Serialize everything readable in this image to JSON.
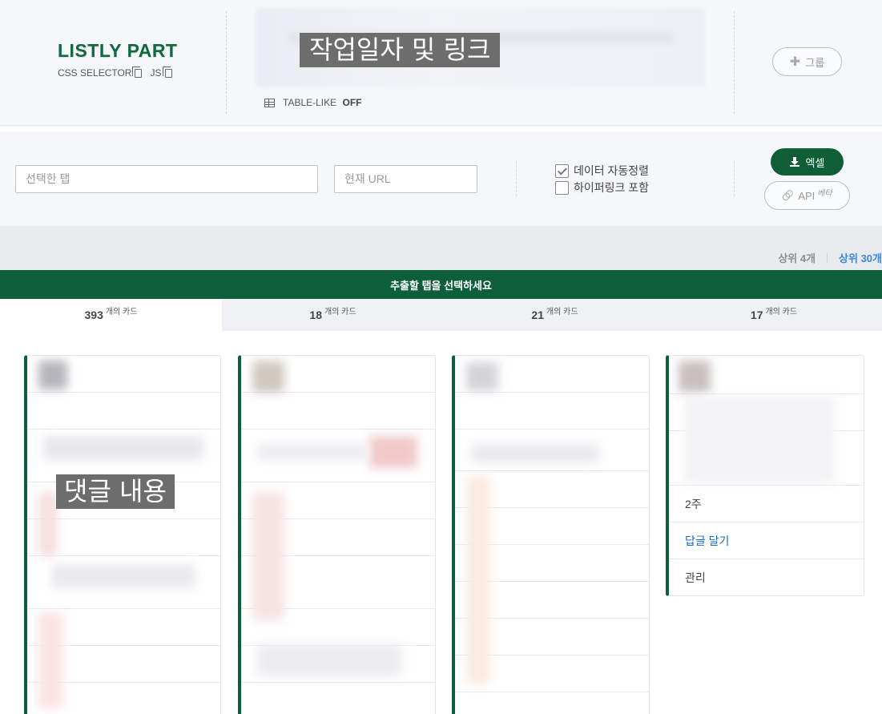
{
  "header": {
    "brand_title": "LISTLY  PART",
    "css_selector_label": "CSS SELECTOR",
    "js_label": "JS",
    "redacted_caption": "작업일자 및 링크",
    "table_like_label": "TABLE-LIKE",
    "table_like_state": "OFF",
    "group_button_label": "그룹"
  },
  "controls": {
    "selected_tab_placeholder": "선택한 탭",
    "current_url_placeholder": "현재 URL",
    "auto_sort_label": "데이터 자동정렬",
    "auto_sort_checked": true,
    "include_hyperlink_label": "하이퍼링크 포함",
    "include_hyperlink_checked": false,
    "excel_button_label": "엑셀",
    "api_button_label": "API",
    "api_beta_label": "베타"
  },
  "top_links": {
    "top4": "상위 4개",
    "top30": "상위 30개"
  },
  "banner": {
    "text": "추출할 탭을 선택하세요"
  },
  "tabs": [
    {
      "count": "393",
      "unit": "개의 카드",
      "active": true
    },
    {
      "count": "18",
      "unit": "개의 카드",
      "active": false
    },
    {
      "count": "21",
      "unit": "개의 카드",
      "active": false
    },
    {
      "count": "17",
      "unit": "개의 카드",
      "active": false
    }
  ],
  "cards": {
    "redacted_caption": "댓글 내용",
    "card4_rows": [
      "2주",
      "답글 달기",
      "관리"
    ]
  },
  "colors": {
    "brand_green": "#0d5e3a",
    "link_blue": "#1b6bbf",
    "top30_blue": "#3d87d8"
  }
}
